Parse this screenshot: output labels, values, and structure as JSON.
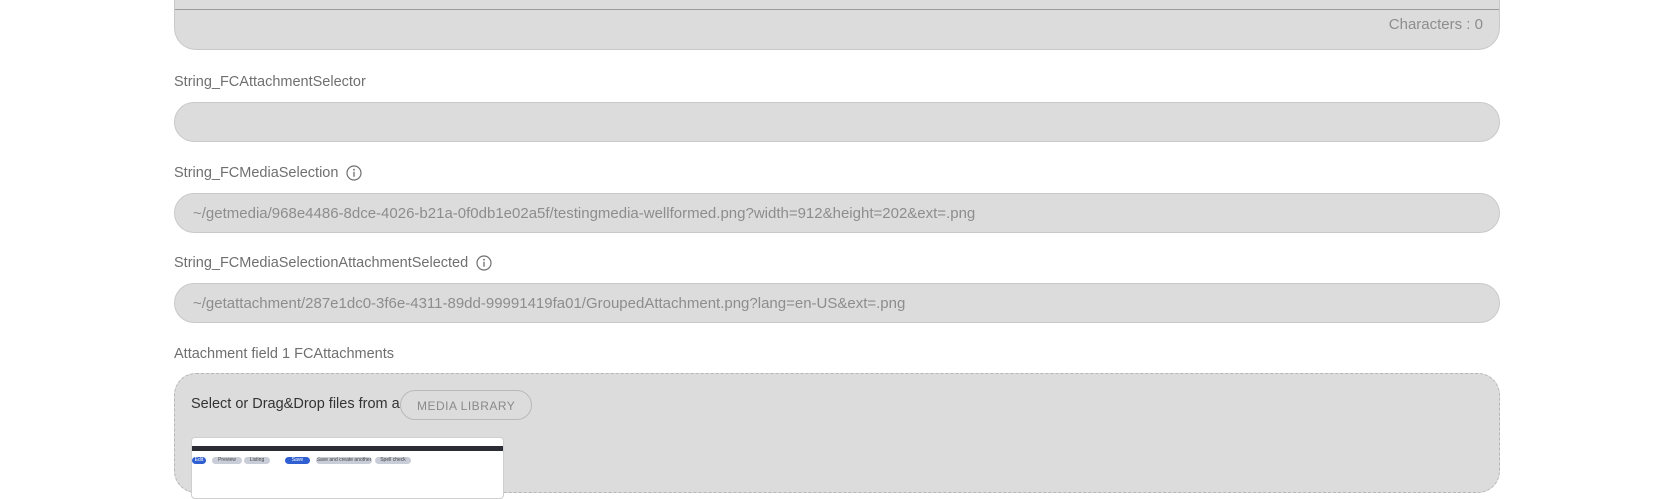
{
  "editor": {
    "char_count": "Characters : 0"
  },
  "fields": {
    "attachment_selector": {
      "label": "String_FCAttachmentSelector",
      "value": ""
    },
    "media_selection": {
      "label": "String_FCMediaSelection",
      "value": "~/getmedia/968e4486-8dce-4026-b21a-0f0db1e02a5f/testingmedia-wellformed.png?width=912&height=202&ext=.png"
    },
    "media_selection_attachment": {
      "label": "String_FCMediaSelectionAttachmentSelected",
      "value": "~/getattachment/287e1dc0-3f6e-4311-89dd-99991419fa01/GroupedAttachment.png?lang=en-US&ext=.png"
    },
    "attachments": {
      "label": "Attachment field 1 FCAttachments",
      "dropzone_text": "Select or Drag&Drop files from a",
      "media_library_label": "MEDIA LIBRARY"
    }
  },
  "thumbnail": {
    "tabs": [
      "Edit",
      "Preview",
      "Listing",
      "Save",
      "Save and create another",
      "Spell check"
    ]
  },
  "colors": {
    "field_bg": "#dcdcdc",
    "label_text": "#6f6f6f",
    "value_text": "#8d8d8d"
  }
}
